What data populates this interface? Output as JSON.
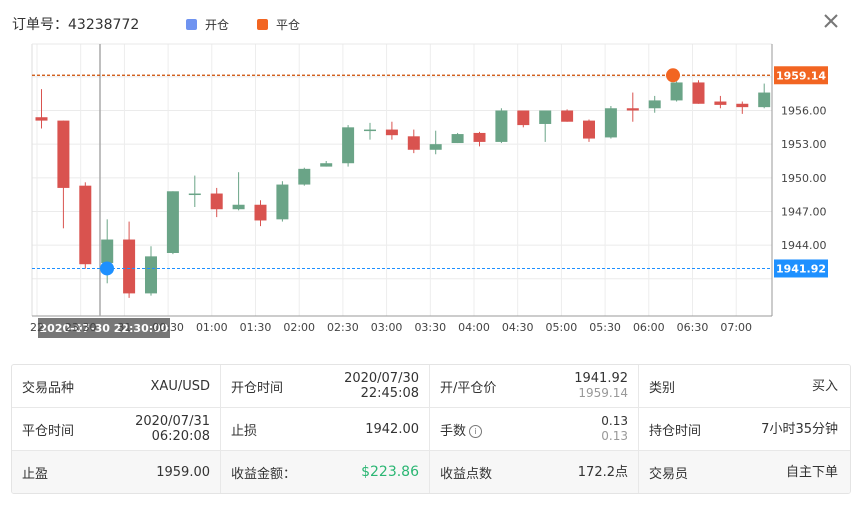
{
  "header": {
    "order_label": "订单号：",
    "order_number": "43238772",
    "legend": [
      {
        "label": "开仓",
        "color": "#6f93f0"
      },
      {
        "label": "平仓",
        "color": "#f26522"
      }
    ]
  },
  "chart_data": {
    "type": "candlestick",
    "y_ticks": [
      "1956.00",
      "1953.00",
      "1950.00",
      "1947.00",
      "1944.00"
    ],
    "y_tick_values": [
      1956,
      1953,
      1950,
      1947,
      1944
    ],
    "x_ticks": [
      "22",
      "23:30",
      "31",
      "00:30",
      "01:00",
      "01:30",
      "02:00",
      "02:30",
      "03:00",
      "03:30",
      "04:00",
      "04:30",
      "05:00",
      "05:30",
      "06:00",
      "06:30",
      "07:00"
    ],
    "crosshair_label": "2020-07-30 22:30:00",
    "open_price_label": "1941.92",
    "close_price_label": "1959.14",
    "open_price": 1941.92,
    "close_price": 1959.14,
    "colors": {
      "up": "#6aa487",
      "down": "#d9534f",
      "open_line": "#1e90ff",
      "close_line": "#cc4b00",
      "open_marker": "#1e90ff",
      "close_marker": "#f26522"
    },
    "candles": [
      {
        "o": 1955.4,
        "c": 1955.1,
        "h": 1957.9,
        "l": 1954.4
      },
      {
        "o": 1955.1,
        "c": 1949.1,
        "h": 1955.1,
        "l": 1945.5
      },
      {
        "o": 1949.3,
        "c": 1942.3,
        "h": 1949.6,
        "l": 1941.9
      },
      {
        "o": 1942.4,
        "c": 1944.5,
        "h": 1946.3,
        "l": 1940.6
      },
      {
        "o": 1944.5,
        "c": 1939.7,
        "h": 1946.1,
        "l": 1939.3
      },
      {
        "o": 1939.7,
        "c": 1943.0,
        "h": 1943.9,
        "l": 1939.5
      },
      {
        "o": 1943.3,
        "c": 1948.8,
        "h": 1948.8,
        "l": 1943.2
      },
      {
        "o": 1948.6,
        "c": 1948.6,
        "h": 1950.2,
        "l": 1947.4
      },
      {
        "o": 1948.6,
        "c": 1947.2,
        "h": 1949.1,
        "l": 1946.5
      },
      {
        "o": 1947.2,
        "c": 1947.6,
        "h": 1950.5,
        "l": 1947.1
      },
      {
        "o": 1947.6,
        "c": 1946.2,
        "h": 1948.0,
        "l": 1945.7
      },
      {
        "o": 1946.3,
        "c": 1949.4,
        "h": 1949.7,
        "l": 1946.1
      },
      {
        "o": 1949.4,
        "c": 1950.8,
        "h": 1950.9,
        "l": 1949.3
      },
      {
        "o": 1951.0,
        "c": 1951.3,
        "h": 1951.5,
        "l": 1951.0
      },
      {
        "o": 1951.3,
        "c": 1954.5,
        "h": 1954.7,
        "l": 1951.0
      },
      {
        "o": 1954.3,
        "c": 1954.3,
        "h": 1954.9,
        "l": 1953.4
      },
      {
        "o": 1954.3,
        "c": 1953.8,
        "h": 1955.0,
        "l": 1953.4
      },
      {
        "o": 1953.7,
        "c": 1952.5,
        "h": 1954.3,
        "l": 1952.2
      },
      {
        "o": 1952.5,
        "c": 1953.0,
        "h": 1954.2,
        "l": 1952.1
      },
      {
        "o": 1953.1,
        "c": 1953.9,
        "h": 1954.0,
        "l": 1953.1
      },
      {
        "o": 1954.0,
        "c": 1953.2,
        "h": 1954.1,
        "l": 1952.8
      },
      {
        "o": 1953.2,
        "c": 1956.0,
        "h": 1956.2,
        "l": 1953.1
      },
      {
        "o": 1956.0,
        "c": 1954.7,
        "h": 1956.0,
        "l": 1954.5
      },
      {
        "o": 1954.8,
        "c": 1956.0,
        "h": 1956.0,
        "l": 1953.2
      },
      {
        "o": 1956.0,
        "c": 1955.0,
        "h": 1956.1,
        "l": 1955.0
      },
      {
        "o": 1955.1,
        "c": 1953.5,
        "h": 1955.2,
        "l": 1953.2
      },
      {
        "o": 1953.6,
        "c": 1956.2,
        "h": 1956.4,
        "l": 1953.5
      },
      {
        "o": 1956.2,
        "c": 1956.0,
        "h": 1957.6,
        "l": 1955.0
      },
      {
        "o": 1956.2,
        "c": 1956.9,
        "h": 1957.3,
        "l": 1955.8
      },
      {
        "o": 1956.9,
        "c": 1958.5,
        "h": 1958.6,
        "l": 1956.8
      },
      {
        "o": 1958.5,
        "c": 1956.6,
        "h": 1958.7,
        "l": 1956.6
      },
      {
        "o": 1956.8,
        "c": 1956.5,
        "h": 1957.3,
        "l": 1956.2
      },
      {
        "o": 1956.6,
        "c": 1956.3,
        "h": 1956.8,
        "l": 1955.7
      },
      {
        "o": 1956.3,
        "c": 1957.6,
        "h": 1958.4,
        "l": 1956.2
      }
    ]
  },
  "table": {
    "rows": [
      [
        {
          "label": "交易品种",
          "value": "XAU/USD"
        },
        {
          "label": "开仓时间",
          "value": "2020/07/30",
          "value2": "22:45:08"
        },
        {
          "label": "开/平仓价",
          "value": "1941.92",
          "sub": "1959.14"
        },
        {
          "label": "类别",
          "value": "买入"
        }
      ],
      [
        {
          "label": "平仓时间",
          "value": "2020/07/31",
          "value2": "06:20:08"
        },
        {
          "label": "止损",
          "value": "1942.00"
        },
        {
          "label": "手数",
          "value": "0.13",
          "sub": "0.13"
        },
        {
          "label": "持仓时间",
          "value": "7小时35分钟"
        }
      ],
      [
        {
          "label": "止盈",
          "value": "1959.00"
        },
        {
          "label": "收益金额：",
          "value": "$223.86"
        },
        {
          "label": "收益点数",
          "value": "172.2点"
        },
        {
          "label": "交易员",
          "value": "自主下单"
        }
      ]
    ]
  }
}
